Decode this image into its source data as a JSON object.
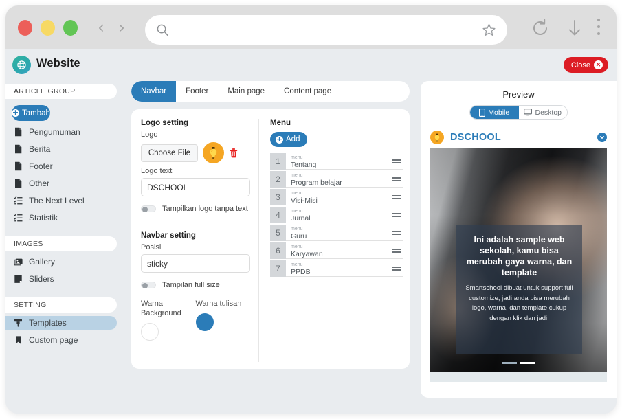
{
  "browser": {
    "url_value": "",
    "url_placeholder": "",
    "icons": {
      "search": "search-icon",
      "bookmark": "star-icon",
      "reload": "reload-icon",
      "download": "download-icon",
      "menu": "kebab-menu-icon",
      "back": "‹",
      "forward": "›"
    }
  },
  "app_header": {
    "title": "Website",
    "close_label": "Close",
    "close_x": "✕"
  },
  "sidebar": {
    "sections": [
      {
        "header": "ARTICLE GROUP",
        "add_button": "Tambah",
        "items": [
          {
            "label": "Pengumuman",
            "icon": "document-icon",
            "active": false
          },
          {
            "label": "Berita",
            "icon": "document-icon",
            "active": false
          },
          {
            "label": "Footer",
            "icon": "document-icon",
            "active": false
          },
          {
            "label": "Other",
            "icon": "document-icon",
            "active": false
          },
          {
            "label": "The Next Level",
            "icon": "list-check-icon",
            "active": false
          },
          {
            "label": "Statistik",
            "icon": "list-check-icon",
            "active": false
          }
        ]
      },
      {
        "header": "IMAGES",
        "items": [
          {
            "label": "Gallery",
            "icon": "image-icon",
            "active": false
          },
          {
            "label": "Sliders",
            "icon": "slider-icon",
            "active": false
          }
        ]
      },
      {
        "header": "SETTING",
        "items": [
          {
            "label": "Templates",
            "icon": "brush-icon",
            "active": true
          },
          {
            "label": "Custom page",
            "icon": "bookmark-icon",
            "active": false
          }
        ]
      }
    ]
  },
  "tabs": [
    {
      "label": "Navbar",
      "active": true
    },
    {
      "label": "Footer",
      "active": false
    },
    {
      "label": "Main page",
      "active": false
    },
    {
      "label": "Content page",
      "active": false
    }
  ],
  "logo_setting": {
    "heading": "Logo setting",
    "logo_label": "Logo",
    "choose_file_label": "Choose File",
    "logo_text_label": "Logo text",
    "logo_text_value": "DSCHOOL",
    "hide_text_toggle_label": "Tampilkan logo tanpa text",
    "hide_text_toggle_on": false
  },
  "navbar_setting": {
    "heading": "Navbar setting",
    "posisi_label": "Posisi",
    "posisi_value": "sticky",
    "full_size_toggle_label": "Tampilan full size",
    "full_size_toggle_on": false,
    "warna_background_label": "Warna Background",
    "warna_background_color": "#ffffff",
    "warna_tulisan_label": "Warna tulisan",
    "warna_tulisan_color": "#2b7cb8"
  },
  "menu_panel": {
    "heading": "Menu",
    "add_label": "Add",
    "items": [
      {
        "index": "1",
        "kind": "menu",
        "name": "Tentang"
      },
      {
        "index": "2",
        "kind": "menu",
        "name": "Program belajar"
      },
      {
        "index": "3",
        "kind": "menu",
        "name": "Visi-Misi"
      },
      {
        "index": "4",
        "kind": "menu",
        "name": "Jurnal"
      },
      {
        "index": "5",
        "kind": "menu",
        "name": "Guru"
      },
      {
        "index": "6",
        "kind": "menu",
        "name": "Karyawan"
      },
      {
        "index": "7",
        "kind": "menu",
        "name": "PPDB"
      }
    ]
  },
  "preview": {
    "title": "Preview",
    "device_mobile_label": "Mobile",
    "device_desktop_label": "Desktop",
    "active_device": "Mobile",
    "site_brand": "DSCHOOL",
    "hero_title": "Ini adalah sample web sekolah, kamu bisa merubah gaya warna, dan template",
    "hero_subtitle": "Smartschool dibuat untuk support full customize, jadi anda bisa merubah logo, warna, dan template cukup dengan klik dan jadi.",
    "carousel_active_index": 1,
    "carousel_count": 2
  },
  "colors": {
    "accent_blue": "#2b7cb8",
    "danger_red": "#dc1c24",
    "logo_orange": "#f5a623",
    "page_background": "#e9ecef"
  }
}
